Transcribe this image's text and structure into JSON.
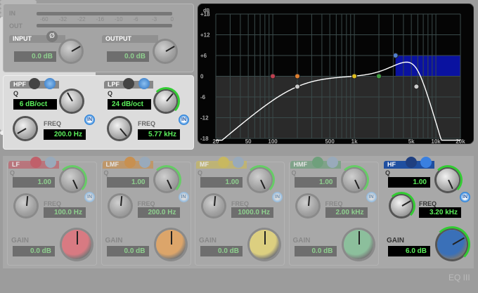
{
  "meters": {
    "in_label": "IN",
    "out_label": "OUT",
    "scale": [
      "-60",
      "-32",
      "-22",
      "-16",
      "-10",
      "-6",
      "-3",
      "0"
    ]
  },
  "input": {
    "label": "INPUT",
    "value": "0.0 dB",
    "phase_icon": "Ø"
  },
  "output": {
    "label": "OUTPUT",
    "value": "0.0 dB"
  },
  "hpf": {
    "label": "HPF",
    "q_label": "Q",
    "q_value": "6 dB/oct",
    "freq_label": "FREQ",
    "freq_value": "200.0 Hz",
    "in_label": "IN"
  },
  "lpf": {
    "label": "LPF",
    "q_label": "Q",
    "q_value": "24 dB/oct",
    "freq_label": "FREQ",
    "freq_value": "5.77 kHz",
    "in_label": "IN"
  },
  "bands": [
    {
      "label": "LF",
      "q_label": "Q",
      "q_value": "1.00",
      "freq_label": "FREQ",
      "freq_value": "100.0 Hz",
      "gain_label": "GAIN",
      "gain_value": "0.0 dB",
      "in_label": "IN",
      "color": "#c0606a",
      "knob": "#d87a82",
      "active": false
    },
    {
      "label": "LMF",
      "q_label": "Q",
      "q_value": "1.00",
      "freq_label": "FREQ",
      "freq_value": "200.0 Hz",
      "gain_label": "GAIN",
      "gain_value": "0.0 dB",
      "in_label": "IN",
      "color": "#c89050",
      "knob": "#dca56a",
      "active": false
    },
    {
      "label": "MF",
      "q_label": "Q",
      "q_value": "1.00",
      "freq_label": "FREQ",
      "freq_value": "1000.0 Hz",
      "gain_label": "GAIN",
      "gain_value": "0.0 dB",
      "in_label": "IN",
      "color": "#c8b860",
      "knob": "#dccf80",
      "active": false
    },
    {
      "label": "HMF",
      "q_label": "Q",
      "q_value": "1.00",
      "freq_label": "FREQ",
      "freq_value": "2.00 kHz",
      "gain_label": "GAIN",
      "gain_value": "0.0 dB",
      "in_label": "IN",
      "color": "#6fa07c",
      "knob": "#8cbf9c",
      "active": false
    },
    {
      "label": "HF",
      "q_label": "Q",
      "q_value": "1.00",
      "freq_label": "FREQ",
      "freq_value": "3.20 kHz",
      "gain_label": "GAIN",
      "gain_value": "6.0 dB",
      "in_label": "IN",
      "color": "#1f4fa0",
      "knob": "#3a70b8",
      "active": true
    }
  ],
  "graph": {
    "unit": "dB",
    "y_ticks": [
      "+18",
      "+12",
      "+6",
      "0",
      "-6",
      "-12",
      "-18"
    ],
    "y_values": [
      18,
      12,
      6,
      0,
      -6,
      -12,
      -18
    ],
    "x_ticks": [
      "20",
      "50",
      "100",
      "500",
      "1k",
      "5k",
      "10k",
      "20k"
    ],
    "x_values": [
      20,
      50,
      100,
      500,
      1000,
      5000,
      10000,
      20000
    ],
    "nodes": [
      {
        "f": 100,
        "db": 0,
        "color": "#c04050"
      },
      {
        "f": 200,
        "db": 0,
        "color": "#e08030"
      },
      {
        "f": 1000,
        "db": 0,
        "color": "#e0c020"
      },
      {
        "f": 2000,
        "db": 0,
        "color": "#40a040"
      },
      {
        "f": 3200,
        "db": 6,
        "color": "#5080d0"
      },
      {
        "f": 200,
        "db": -3,
        "color": "#cccccc"
      },
      {
        "f": 5770,
        "db": -3,
        "color": "#cccccc"
      }
    ]
  },
  "footer": "EQ III"
}
